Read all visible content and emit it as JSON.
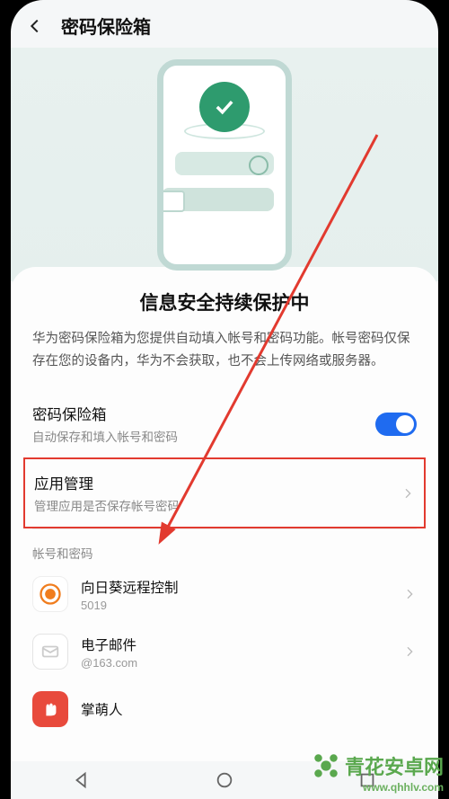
{
  "header": {
    "title": "密码保险箱"
  },
  "main": {
    "title": "信息安全持续保护中",
    "description": "华为密码保险箱为您提供自动填入帐号和密码功能。帐号密码仅保存在您的设备内，华为不会获取，也不会上传网络或服务器。"
  },
  "settings": {
    "vault": {
      "title": "密码保险箱",
      "subtitle": "自动保存和填入帐号和密码",
      "enabled": true
    },
    "app_management": {
      "title": "应用管理",
      "subtitle": "管理应用是否保存帐号密码"
    }
  },
  "accounts": {
    "section_label": "帐号和密码",
    "items": [
      {
        "name": "向日葵远程控制",
        "detail": "5019"
      },
      {
        "name": "电子邮件",
        "detail": "@163.com"
      },
      {
        "name": "掌萌人",
        "detail": ""
      }
    ]
  },
  "watermark": {
    "brand": "青花安卓网",
    "url": "www.qhhlv.com"
  },
  "annotation": {
    "highlighted_item": "app_management"
  }
}
